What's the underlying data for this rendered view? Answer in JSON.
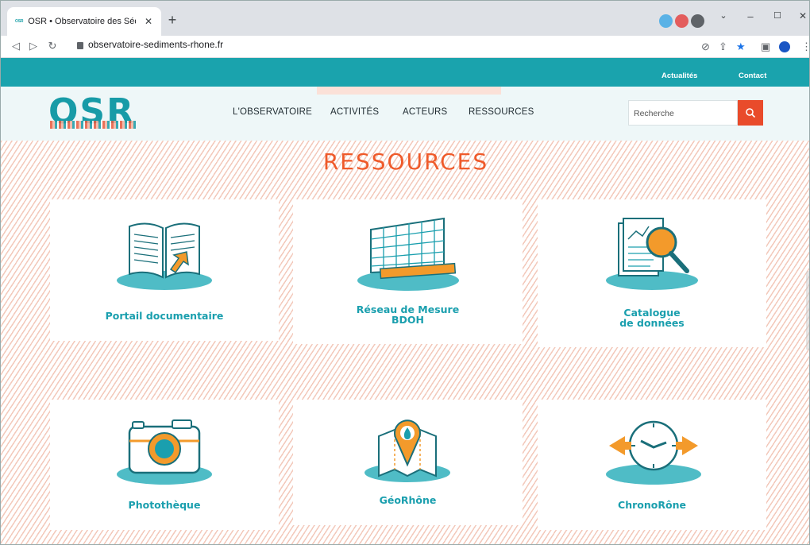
{
  "browser": {
    "tab_title": "OSR • Observatoire des Sédiments",
    "tab_favicon": "OSR",
    "url": "observatoire-sediments-rhone.fr"
  },
  "site": {
    "top_links": [
      "Actualités",
      "Contact"
    ],
    "logo": "OSR",
    "nav": [
      "L'OBSERVATOIRE",
      "ACTIVITÉS",
      "ACTEURS",
      "RESSOURCES"
    ],
    "search_placeholder": "Recherche",
    "page_title": "RESSOURCES"
  },
  "cards": [
    {
      "label_lines": [
        "Portail documentaire"
      ],
      "icon": "open-book-icon"
    },
    {
      "label_lines": [
        "Réseau de Mesure",
        "BDOH"
      ],
      "icon": "measure-grid-icon"
    },
    {
      "label_lines": [
        "Catalogue",
        "de données"
      ],
      "icon": "magnifier-document-icon"
    },
    {
      "label_lines": [
        "Photothèque"
      ],
      "icon": "camera-icon"
    },
    {
      "label_lines": [
        "GéoRhône"
      ],
      "icon": "map-pin-icon"
    },
    {
      "label_lines": [
        "ChronoRône"
      ],
      "icon": "clock-icon"
    }
  ],
  "colors": {
    "accent_teal": "#1aa3ad",
    "accent_orange": "#ef5a2a",
    "icon_orange": "#f39a2b"
  }
}
